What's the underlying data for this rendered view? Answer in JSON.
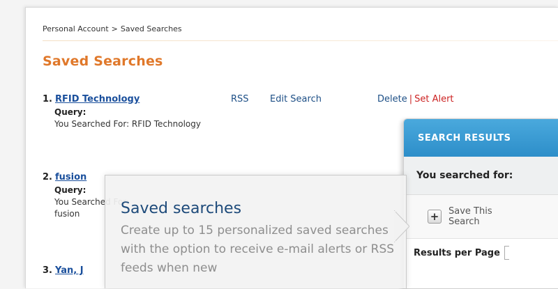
{
  "breadcrumb": {
    "root": "Personal Account",
    "separator": ">",
    "current": "Saved Searches"
  },
  "page_title": "Saved Searches",
  "searches": [
    {
      "number": "1.",
      "title": "RFID Technology",
      "rss": "RSS",
      "edit": "Edit Search",
      "delete": "Delete",
      "alert": "Set Alert",
      "query_label": "Query:",
      "query_text": "You Searched For:  RFID Technology"
    },
    {
      "number": "2.",
      "title": "fusion",
      "query_label": "Query:",
      "query_text": "You Searched For: fusion"
    },
    {
      "number": "3.",
      "title": "Yan, J"
    }
  ],
  "results_panel": {
    "header": "SEARCH RESULTS",
    "searched_for": "You searched for:",
    "save_label": "Save This Search",
    "results_per_page": "Results per Page"
  },
  "callout": {
    "title": "Saved searches",
    "body": "Create up to 15 personalized saved searches with the option to receive e-mail alerts or RSS feeds when new"
  },
  "icons": {
    "save": "plus-icon"
  },
  "colors": {
    "title": "#e0782a",
    "link": "#1a4f9c",
    "alert": "#cc2222",
    "header": "#3a9dd4",
    "callout_title": "#1d4a7a"
  }
}
